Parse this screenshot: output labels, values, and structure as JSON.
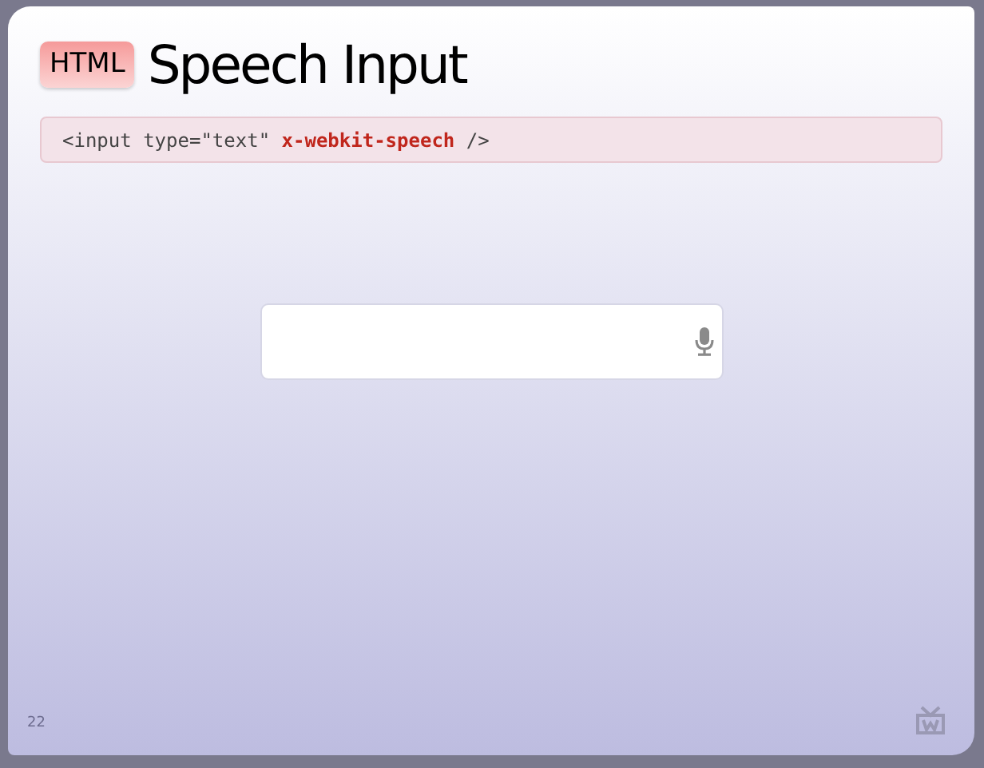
{
  "slide": {
    "badge": "HTML",
    "title": "Speech Input",
    "code": [
      {
        "kind": "plain",
        "text": "<input type=\"text\" "
      },
      {
        "kind": "keyword",
        "text": "x-webkit-speech"
      },
      {
        "kind": "plain",
        "text": " />"
      }
    ],
    "page_number": "22"
  }
}
